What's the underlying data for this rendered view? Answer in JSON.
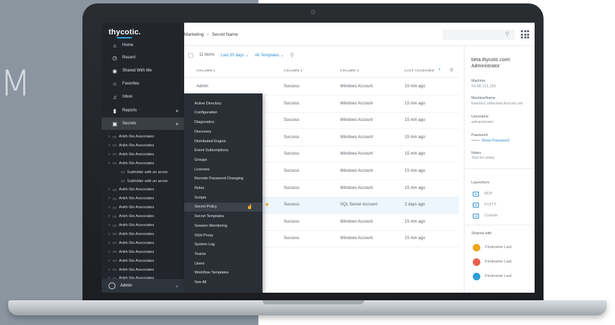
{
  "backdrop": {
    "letter": "M"
  },
  "sidebar": {
    "logo": "thycotic.",
    "nav": [
      {
        "icon": "home-icon",
        "glyph": "⌂",
        "label": "Home"
      },
      {
        "icon": "clock-icon",
        "glyph": "◷",
        "label": "Recent"
      },
      {
        "icon": "share-icon",
        "glyph": "◉",
        "label": "Shared With Me"
      },
      {
        "icon": "star-icon",
        "glyph": "☆",
        "label": "Favorites"
      },
      {
        "icon": "bell-icon",
        "glyph": "♫",
        "label": "Inbox"
      },
      {
        "icon": "chart-icon",
        "glyph": "▮",
        "label": "Reports"
      },
      {
        "icon": "lock-icon",
        "glyph": "▣",
        "label": "Secrets"
      }
    ],
    "tree": [
      "Ankh-Sto Associates",
      "Ankh-Sto Associates",
      "Ankh-Sto Associates",
      "Ankh-Sto Associates",
      "Subfolder with an arrow",
      "Subfolder with an arrow",
      "Ankh-Sto Associates",
      "Ankh-Sto Associates",
      "Ankh-Sto Associates",
      "Ankh-Sto Associates",
      "Ankh-Sto Associates",
      "Ankh-Sto Associates",
      "Ankh-Sto Associates",
      "Ankh-Sto Associates",
      "Ankh-Sto Associates",
      "Ankh-Sto Associates",
      "Ankh-Sto Associates"
    ],
    "admin_label": "Admin"
  },
  "topbar": {
    "crumb_root": "Marketing",
    "crumb_sep": ">",
    "crumb_leaf": "Secret Name"
  },
  "filters": {
    "count": "11 items",
    "date": "Last 30 days",
    "templates": "All Templates"
  },
  "table": {
    "headers": [
      "COLUMN 1",
      "COLUMN 2",
      "COLUMN 3",
      "LAST ACCESSED"
    ],
    "add_glyph": "+",
    "rows": [
      {
        "c1": "Admin",
        "c2": "Success",
        "c3": "Windows Account",
        "c4": "15 min ago",
        "selected": false
      },
      {
        "c1": "",
        "c2": "Success",
        "c3": "Windows Account",
        "c4": "15 min ago",
        "selected": false
      },
      {
        "c1": "",
        "c2": "Success",
        "c3": "Windows Account",
        "c4": "15 min ago",
        "selected": false
      },
      {
        "c1": "",
        "c2": "Success",
        "c3": "Windows Account",
        "c4": "15 min ago",
        "selected": false
      },
      {
        "c1": "",
        "c2": "Success",
        "c3": "Windows Account",
        "c4": "15 min ago",
        "selected": false
      },
      {
        "c1": "",
        "c2": "Success",
        "c3": "Windows Account",
        "c4": "15 min ago",
        "selected": false
      },
      {
        "c1": "",
        "c2": "Success",
        "c3": "Windows Account",
        "c4": "15 min ago",
        "selected": false
      },
      {
        "c1": "",
        "c2": "Success",
        "c3": "SQL Server Account",
        "c4": "2 days ago",
        "selected": true
      },
      {
        "c1": "",
        "c2": "Success",
        "c3": "Windows Account",
        "c4": "15 min ago",
        "selected": false
      },
      {
        "c1": "",
        "c2": "Success",
        "c3": "Windows Account",
        "c4": "15 min ago",
        "selected": false
      }
    ]
  },
  "admin_menu": {
    "items": [
      "Active Directory",
      "Configuration",
      "Diagnostics",
      "Discovery",
      "Distributed Engine",
      "Event Subscriptions",
      "Groups",
      "Licenses",
      "Remote Password Changing",
      "Roles",
      "Scripts",
      "Secret Policy",
      "Secret Templates",
      "Session Monitoring",
      "SSH Proxy",
      "System Log",
      "Teams",
      "Users",
      "Workflow Templates",
      "See All"
    ],
    "hovered_index": 11
  },
  "details": {
    "host": "beta.thycotic.com\\ Administrator",
    "fields": [
      {
        "label": "Machine",
        "value": "54.68.121.155"
      },
      {
        "label": "MachineName",
        "value": "bastion1.unlocked.thycotic.net"
      },
      {
        "label": "Username",
        "value": "administrator"
      },
      {
        "label": "Password",
        "value": "••••••",
        "extra": "Show Password"
      },
      {
        "label": "Notes",
        "value": "Test for notes"
      }
    ],
    "launchers_title": "Launchers",
    "launchers": [
      "RDP",
      "PuTTY",
      "Custom"
    ],
    "shared_title": "Shared with",
    "shared": [
      {
        "name": "Firstname Last",
        "color": "#f0a51e"
      },
      {
        "name": "Firstname Last",
        "color": "#e8604f"
      },
      {
        "name": "Firstname Last",
        "color": "#2e9fd6"
      }
    ]
  },
  "colors": {
    "accent": "#2e8fd0",
    "sidebar": "#22262c",
    "star": "#f0a51e"
  }
}
